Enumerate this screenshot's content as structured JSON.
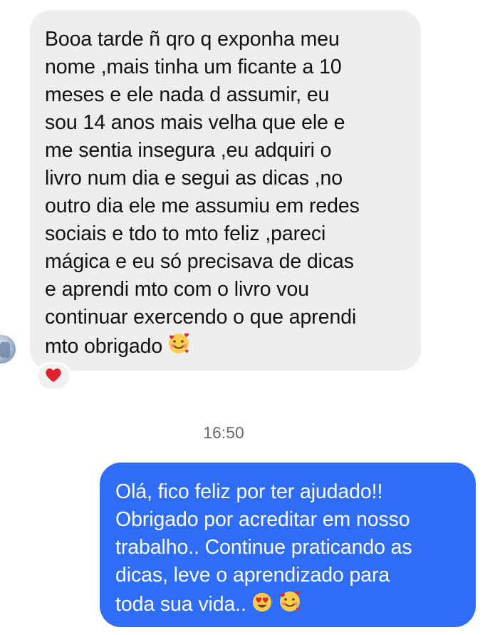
{
  "received_message": {
    "text": "Booa tarde ñ qro q exponha meu\nnome ,mais tinha um ficante a 10\nmeses e ele nada d assumir, eu\nsou 14 anos mais velha que ele e\nme sentia insegura ,eu adquiri o\nlivro num dia e segui as dicas ,no\noutro dia ele me assumiu em redes\nsociais e tdo to mto feliz ,pareci\nmágica e eu só precisava de dicas\ne aprendi mto com o livro vou\ncontinuar exercendo o que aprendi\nmto obrigado",
    "trailing_emoji": "smiling-face-with-hearts",
    "reaction": "red-heart"
  },
  "timestamp": "16:50",
  "sent_message": {
    "text": "Olá, fico feliz por ter ajudado!!\nObrigado por acreditar em nosso\ntrabalho.. Continue praticando as\ndicas, leve o aprendizado para\ntoda sua vida..",
    "trailing_emojis": [
      "heart-eyes",
      "smiling-face-with-hearts"
    ]
  },
  "colors": {
    "received_bubble": "#eeeeef",
    "sent_bubble": "#2f6df6",
    "reaction_heart": "#e0242c"
  }
}
